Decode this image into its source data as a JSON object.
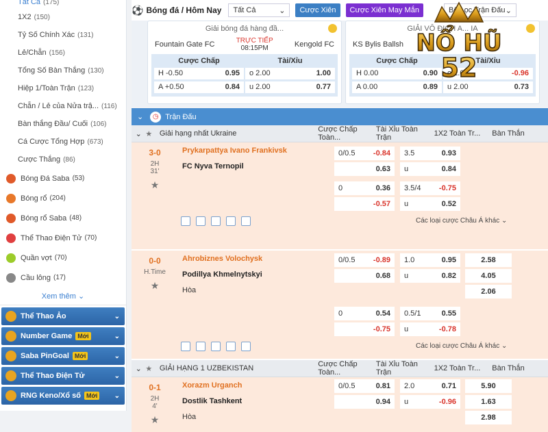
{
  "sidebar": {
    "top": {
      "label": "Tất Cả",
      "count": "(175)"
    },
    "items": [
      {
        "label": "1X2",
        "count": "(150)"
      },
      {
        "label": "Tỷ Số Chính Xác",
        "count": "(131)"
      },
      {
        "label": "Lẻ/Chẵn",
        "count": "(156)"
      },
      {
        "label": "Tổng Số Bàn Thắng",
        "count": "(130)"
      },
      {
        "label": "Hiệp 1/Toàn Trận",
        "count": "(123)"
      },
      {
        "label": "Chẵn / Lẻ của Nửa trậ...",
        "count": "(116)"
      },
      {
        "label": "Bàn thắng Đầu/ Cuối",
        "count": "(106)"
      },
      {
        "label": "Cá Cược Tổng Hợp",
        "count": "(673)"
      },
      {
        "label": "Cược Thắng",
        "count": "(86)"
      }
    ],
    "sports": [
      {
        "label": "Bóng Đá Saba",
        "count": "(53)",
        "color": "#e05a2a"
      },
      {
        "label": "Bóng rổ",
        "count": "(204)",
        "color": "#e8782a"
      },
      {
        "label": "Bóng rổ Saba",
        "count": "(48)",
        "color": "#e05a2a"
      },
      {
        "label": "Thể Thao Điện Tử",
        "count": "(70)",
        "color": "#e04040"
      },
      {
        "label": "Quần vợt",
        "count": "(70)",
        "color": "#9ccc2a"
      },
      {
        "label": "Cầu lông",
        "count": "(17)",
        "color": "#888888"
      }
    ],
    "more": "Xem thêm",
    "cats": [
      {
        "label": "Thể Thao Ảo",
        "new": ""
      },
      {
        "label": "Number Game",
        "new": "Mới"
      },
      {
        "label": "Saba PinGoal",
        "new": "Mới"
      },
      {
        "label": "Thể Thao Điện Tử",
        "new": ""
      },
      {
        "label": "RNG Keno/Xổ số",
        "new": "Mới"
      }
    ]
  },
  "topbar": {
    "title": "Bóng đá / Hôm Nay",
    "select": "Tất Cả",
    "btn1": "Cược Xiên",
    "btn2": "Cược Xiên May Mắn",
    "filter": "Bộ Lọc Trận Đấu"
  },
  "cards": [
    {
      "league": "Giải bóng đá hàng đầ...",
      "home": "Fountain Gate FC",
      "away": "Kengold FC",
      "live": "TRỰC TIẾP",
      "time": "08:15PM",
      "h1": "Cược Chấp",
      "h2": "Tài/Xỉu",
      "r1": [
        "H -0.50",
        "0.95",
        "o 2.00",
        "1.00"
      ],
      "r2": [
        "A +0.50",
        "0.84",
        "u 2.00",
        "0.77"
      ]
    },
    {
      "league": "GIẢI VÔ ĐỊCH A... IA",
      "home": "KS Bylis Ballsh",
      "away": "",
      "live": "",
      "time": "",
      "h1": "Cược Chấp",
      "h2": "Tài/Xỉu",
      "r1": [
        "H 0.00",
        "0.90",
        "o 2.00",
        "-0.96"
      ],
      "r2": [
        "A 0.00",
        "0.89",
        "u 2.00",
        "0.73"
      ]
    }
  ],
  "logo": {
    "line1": "NỔ HŨ",
    "line2": "52"
  },
  "main": {
    "section": "Trận Đấu",
    "leagues": [
      {
        "name": "Giải hạng nhất Ukraine",
        "cols": [
          "Cược Chấp Toàn...",
          "Tài Xỉu Toàn Trận",
          "1X2 Toàn Tr...",
          "Bàn Thắn"
        ]
      },
      {
        "name": "GIẢI HẠNG 1 UZBEKISTAN",
        "cols": [
          "Cược Chấp Toàn...",
          "Tài Xỉu Toàn Trận",
          "1X2 Toàn Tr...",
          "Bàn Thắn"
        ]
      }
    ],
    "matches": [
      {
        "score": "3-0",
        "t1": "2H",
        "t2": "31'",
        "home": "Prykarpattya Ivano Frankivsk",
        "away": "FC Nyva Ternopil",
        "draw": "",
        "rows": [
          [
            "0/0.5",
            "-0.84",
            "3.5",
            "0.93",
            ""
          ],
          [
            "",
            "0.63",
            "u",
            "0.84",
            ""
          ],
          [
            "0",
            "0.36",
            "3.5/4",
            "-0.75",
            ""
          ],
          [
            "",
            "-0.57",
            "u",
            "0.52",
            ""
          ]
        ],
        "more": "Các loại cược Châu Á khác"
      },
      {
        "score": "0-0",
        "t1": "H.Time",
        "t2": "",
        "home": "Ahrobiznes Volochysk",
        "away": "Podillya Khmelnytskyi",
        "draw": "Hòa",
        "rows": [
          [
            "0/0.5",
            "-0.89",
            "1.0",
            "0.95",
            "2.58"
          ],
          [
            "",
            "0.68",
            "u",
            "0.82",
            "4.05"
          ],
          [
            "",
            "",
            "",
            "",
            "2.06"
          ],
          [
            "0",
            "0.54",
            "0.5/1",
            "0.55",
            ""
          ],
          [
            "",
            "-0.75",
            "u",
            "-0.78",
            ""
          ]
        ],
        "more": "Các loại cược Châu Á khác"
      },
      {
        "score": "0-1",
        "t1": "2H",
        "t2": "4'",
        "home": "Xorazm Urganch",
        "away": "Dostlik Tashkent",
        "draw": "Hòa",
        "rows": [
          [
            "0/0.5",
            "0.81",
            "2.0",
            "0.71",
            "5.90"
          ],
          [
            "",
            "0.94",
            "u",
            "-0.96",
            "1.63"
          ],
          [
            "",
            "",
            "",
            "",
            "2.98"
          ]
        ],
        "more": ""
      }
    ]
  }
}
